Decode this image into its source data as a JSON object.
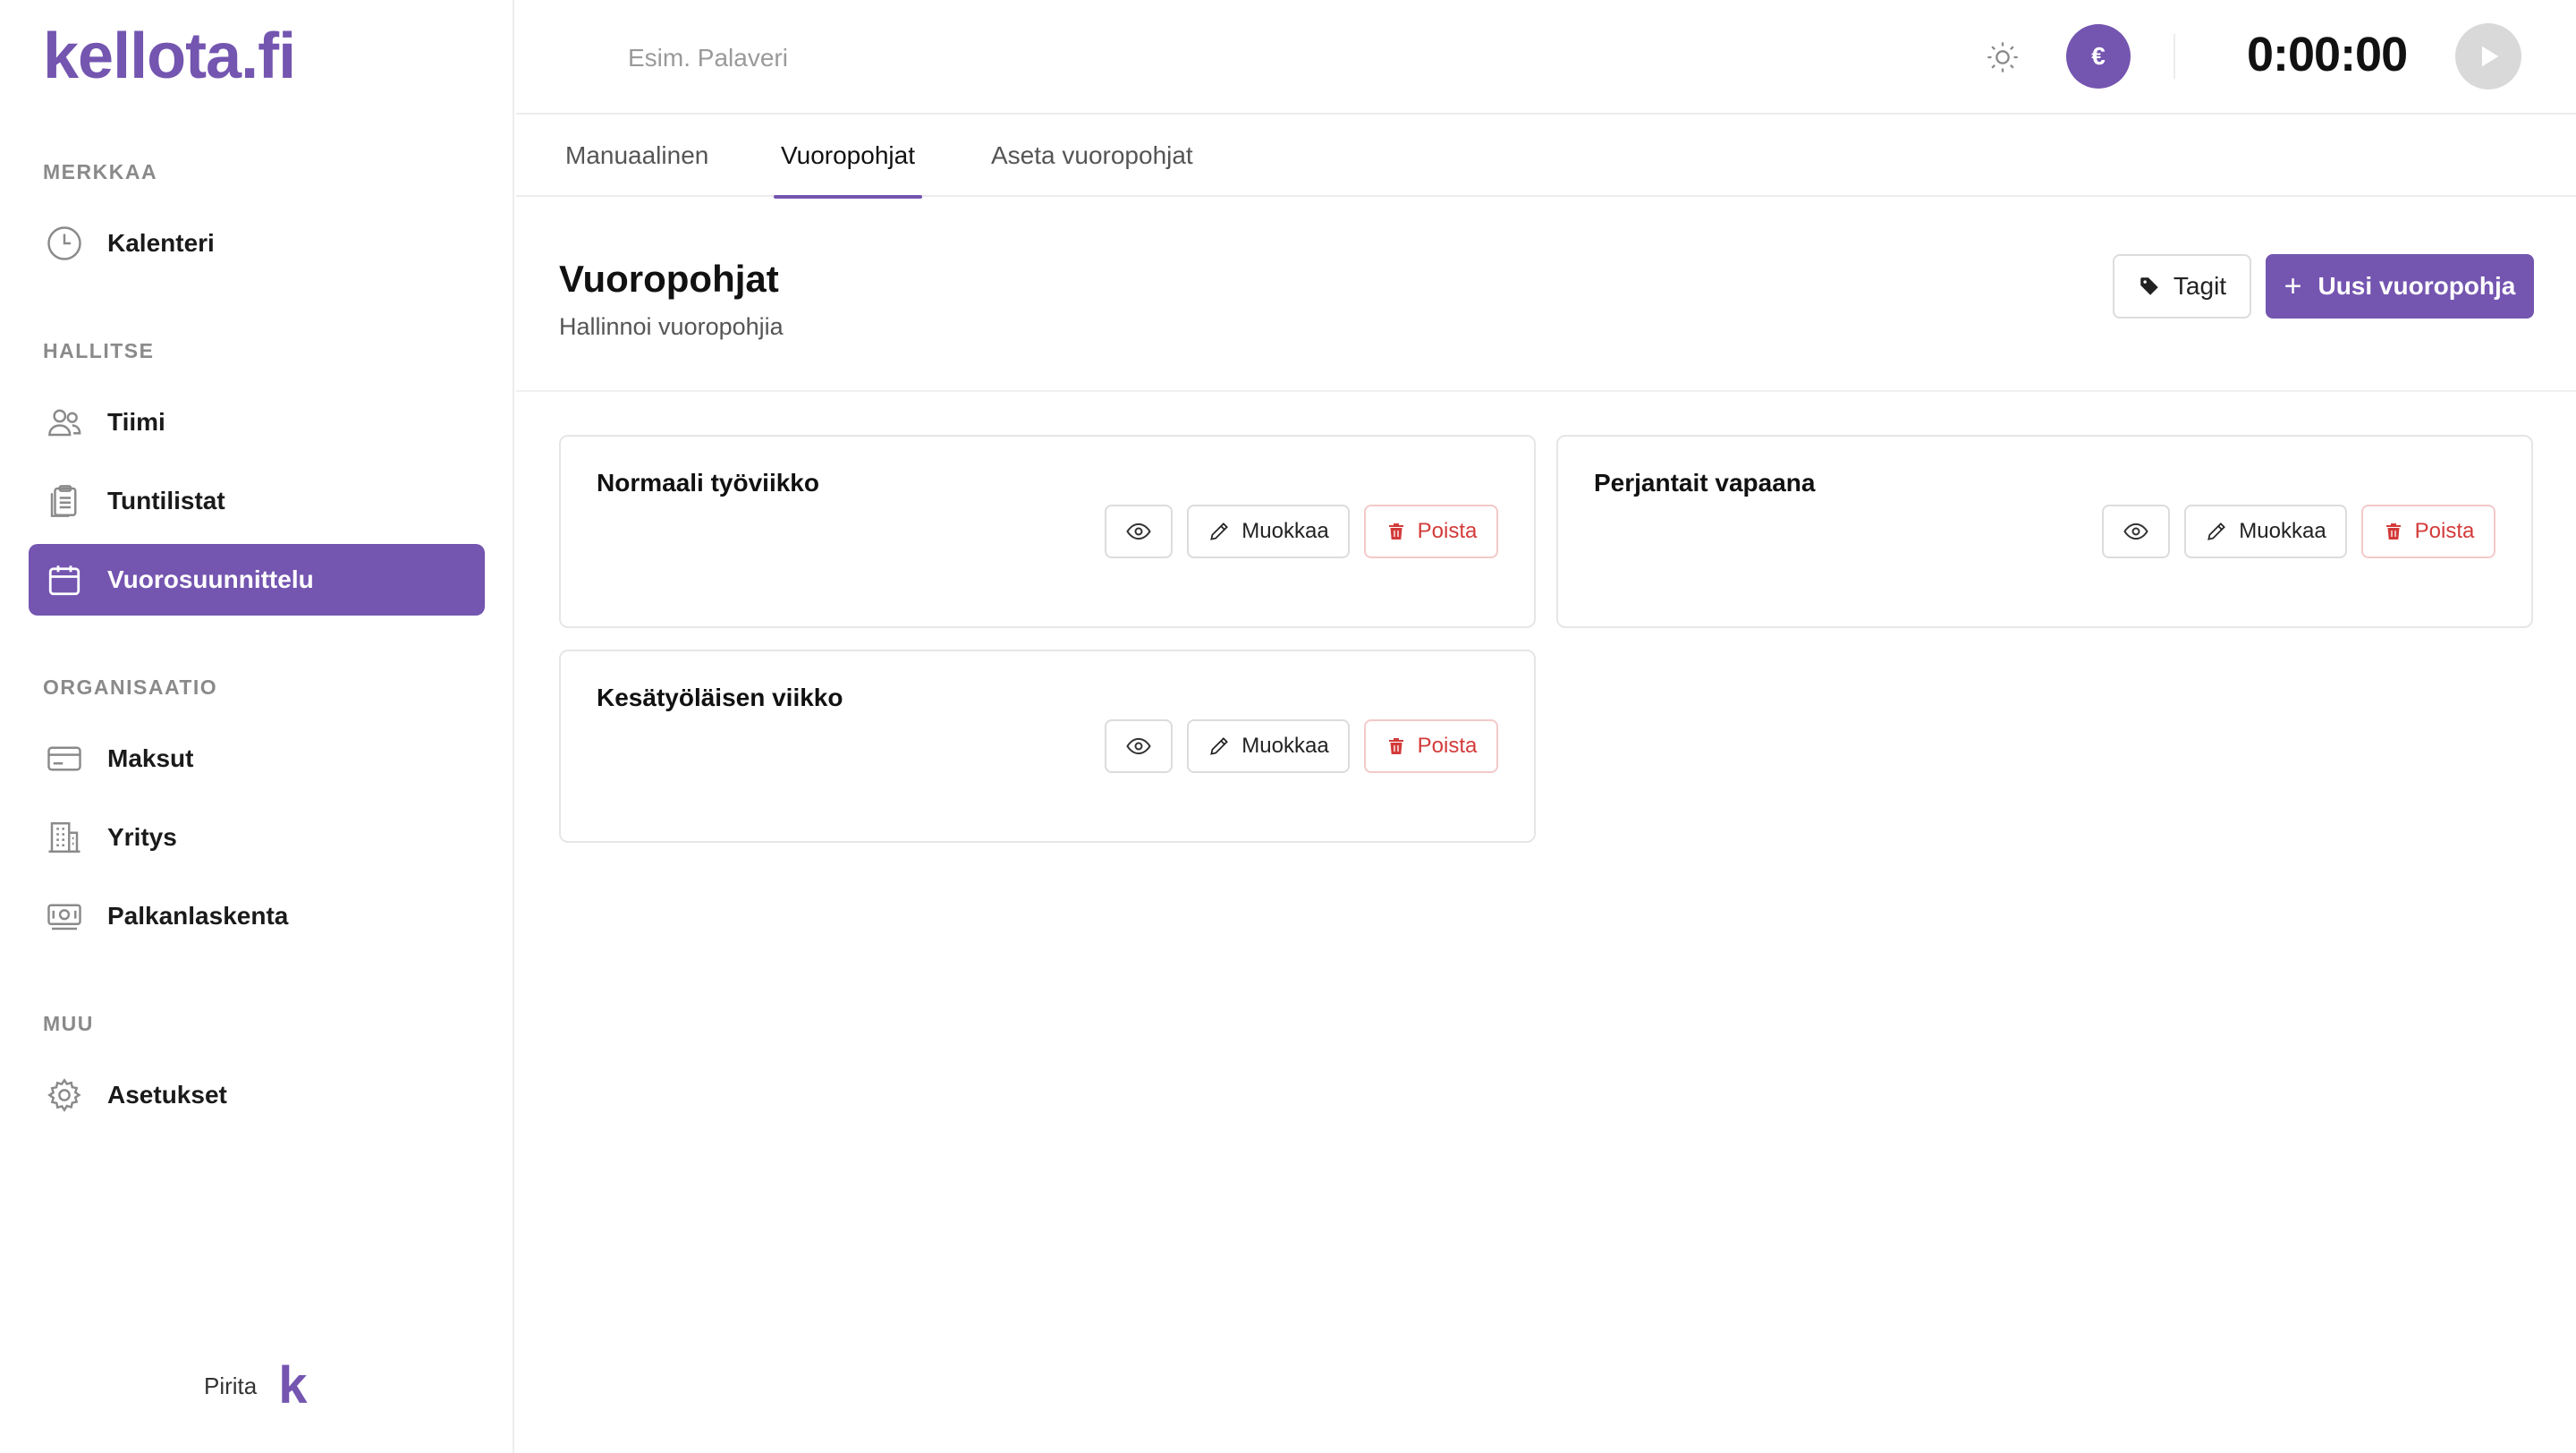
{
  "app": {
    "logo": "kellota.fi",
    "brand_color": "#7455b0"
  },
  "sidebar": {
    "sections": [
      {
        "title": "MERKKAA"
      },
      {
        "title": "HALLITSE"
      },
      {
        "title": "ORGANISAATIO"
      },
      {
        "title": "MUU"
      }
    ],
    "items": [
      {
        "label": "Kalenteri",
        "icon": "clock-icon"
      },
      {
        "label": "Tiimi",
        "icon": "users-icon"
      },
      {
        "label": "Tuntilistat",
        "icon": "clipboard-icon"
      },
      {
        "label": "Vuorosuunnittelu",
        "icon": "calendar-icon",
        "active": true
      },
      {
        "label": "Maksut",
        "icon": "credit-card-icon"
      },
      {
        "label": "Yritys",
        "icon": "building-icon"
      },
      {
        "label": "Palkanlaskenta",
        "icon": "banknote-icon"
      },
      {
        "label": "Asetukset",
        "icon": "gear-icon"
      }
    ],
    "footer": {
      "user_name": "Pirita",
      "logo_letter": "k"
    }
  },
  "topbar": {
    "task_placeholder": "Esim. Palaveri",
    "euro_symbol": "€",
    "timer": "0:00:00"
  },
  "tabs": [
    {
      "label": "Manuaalinen"
    },
    {
      "label": "Vuoropohjat",
      "active": true
    },
    {
      "label": "Aseta vuoropohjat"
    }
  ],
  "page": {
    "title": "Vuoropohjat",
    "subtitle": "Hallinnoi vuoropohjia",
    "tags_label": "Tagit",
    "new_label": "Uusi vuoropohja"
  },
  "templates": [
    {
      "name": "Normaali työviikko",
      "edit_label": "Muokkaa",
      "delete_label": "Poista"
    },
    {
      "name": "Perjantait vapaana",
      "edit_label": "Muokkaa",
      "delete_label": "Poista"
    },
    {
      "name": "Kesätyöläisen viikko",
      "edit_label": "Muokkaa",
      "delete_label": "Poista"
    }
  ]
}
